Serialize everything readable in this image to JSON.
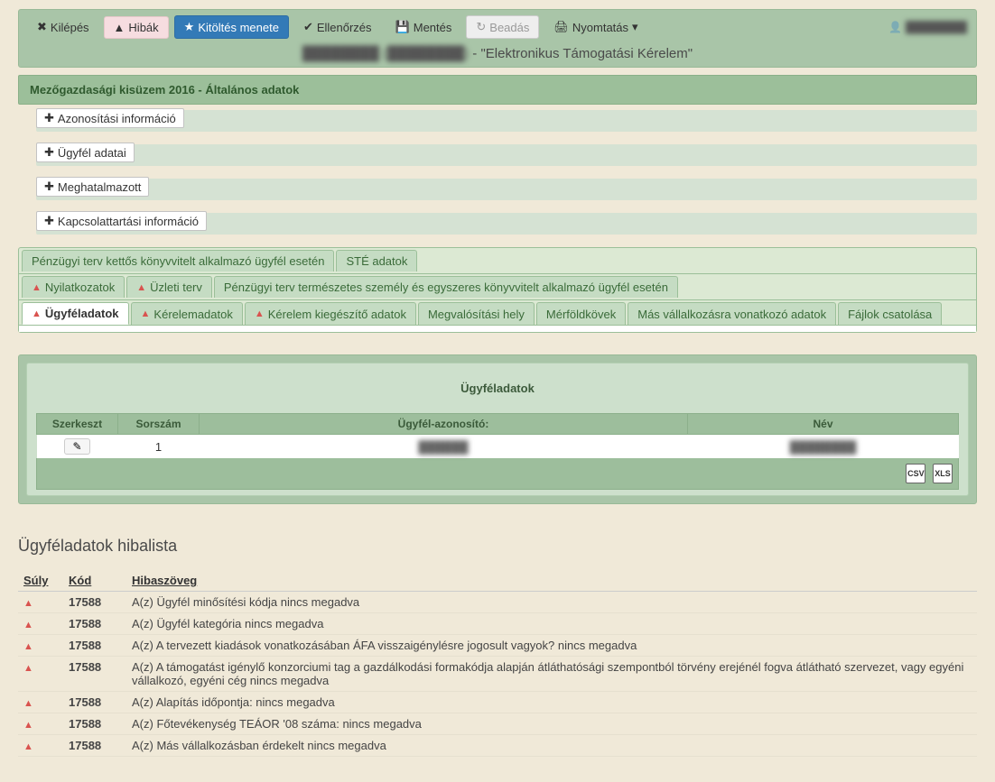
{
  "toolbar": {
    "exit": "Kilépés",
    "errors": "Hibák",
    "fill_flow": "Kitöltés menete",
    "check": "Ellenőrzés",
    "save": "Mentés",
    "submit": "Beadás",
    "print": "Nyomtatás",
    "user_name": "████████"
  },
  "subtitle": {
    "prefix_hidden": "████████ (████████)",
    "suffix": " - \"Elektronikus Támogatási Kérelem\""
  },
  "section_header": "Mezőgazdasági kisüzem 2016 - Általános adatok",
  "collapsibles": [
    "Azonosítási információ",
    "Ügyfél adatai",
    "Meghatalmazott",
    "Kapcsolattartási információ"
  ],
  "tabs_row1": [
    {
      "label": "Pénzügyi terv kettős könyvvitelt alkalmazó ügyfél esetén",
      "warn": false
    },
    {
      "label": "STÉ adatok",
      "warn": false
    }
  ],
  "tabs_row2": [
    {
      "label": "Nyilatkozatok",
      "warn": true
    },
    {
      "label": "Üzleti terv",
      "warn": true
    },
    {
      "label": "Pénzügyi terv természetes személy és egyszeres könyvvitelt alkalmazó ügyfél esetén",
      "warn": false
    }
  ],
  "tabs_row3": [
    {
      "label": "Ügyféladatok",
      "warn": true,
      "active": true
    },
    {
      "label": "Kérelemadatok",
      "warn": true
    },
    {
      "label": "Kérelem kiegészítő adatok",
      "warn": true
    },
    {
      "label": "Megvalósítási hely",
      "warn": false
    },
    {
      "label": "Mérföldkövek",
      "warn": false
    },
    {
      "label": "Más vállalkozásra vonatkozó adatok",
      "warn": false
    },
    {
      "label": "Fájlok csatolása",
      "warn": false
    }
  ],
  "client_panel": {
    "title": "Ügyféladatok",
    "columns": [
      "Szerkeszt",
      "Sorszám",
      "Ügyfél-azonosító:",
      "Név"
    ],
    "rows": [
      {
        "index": "1",
        "client_id": "██████",
        "name": "████████"
      }
    ],
    "export_csv": "CSV",
    "export_xls": "XLS"
  },
  "error_list": {
    "title": "Ügyféladatok hibalista",
    "columns": [
      "Súly",
      "Kód",
      "Hibaszöveg"
    ],
    "rows": [
      {
        "code": "17588",
        "text": "A(z) Ügyfél minősítési kódja nincs megadva"
      },
      {
        "code": "17588",
        "text": "A(z) Ügyfél kategória nincs megadva"
      },
      {
        "code": "17588",
        "text": "A(z) A tervezett kiadások vonatkozásában ÁFA visszaigénylésre jogosult vagyok? nincs megadva"
      },
      {
        "code": "17588",
        "text": "A(z) A támogatást igénylő konzorciumi tag a gazdálkodási formakódja alapján átláthatósági szempontból törvény erejénél fogva átlátható szervezet, vagy egyéni vállalkozó, egyéni cég nincs megadva"
      },
      {
        "code": "17588",
        "text": "A(z) Alapítás időpontja: nincs megadva"
      },
      {
        "code": "17588",
        "text": "A(z) Főtevékenység TEÁOR '08 száma: nincs megadva"
      },
      {
        "code": "17588",
        "text": "A(z) Más vállalkozásban érdekelt nincs megadva"
      }
    ]
  }
}
